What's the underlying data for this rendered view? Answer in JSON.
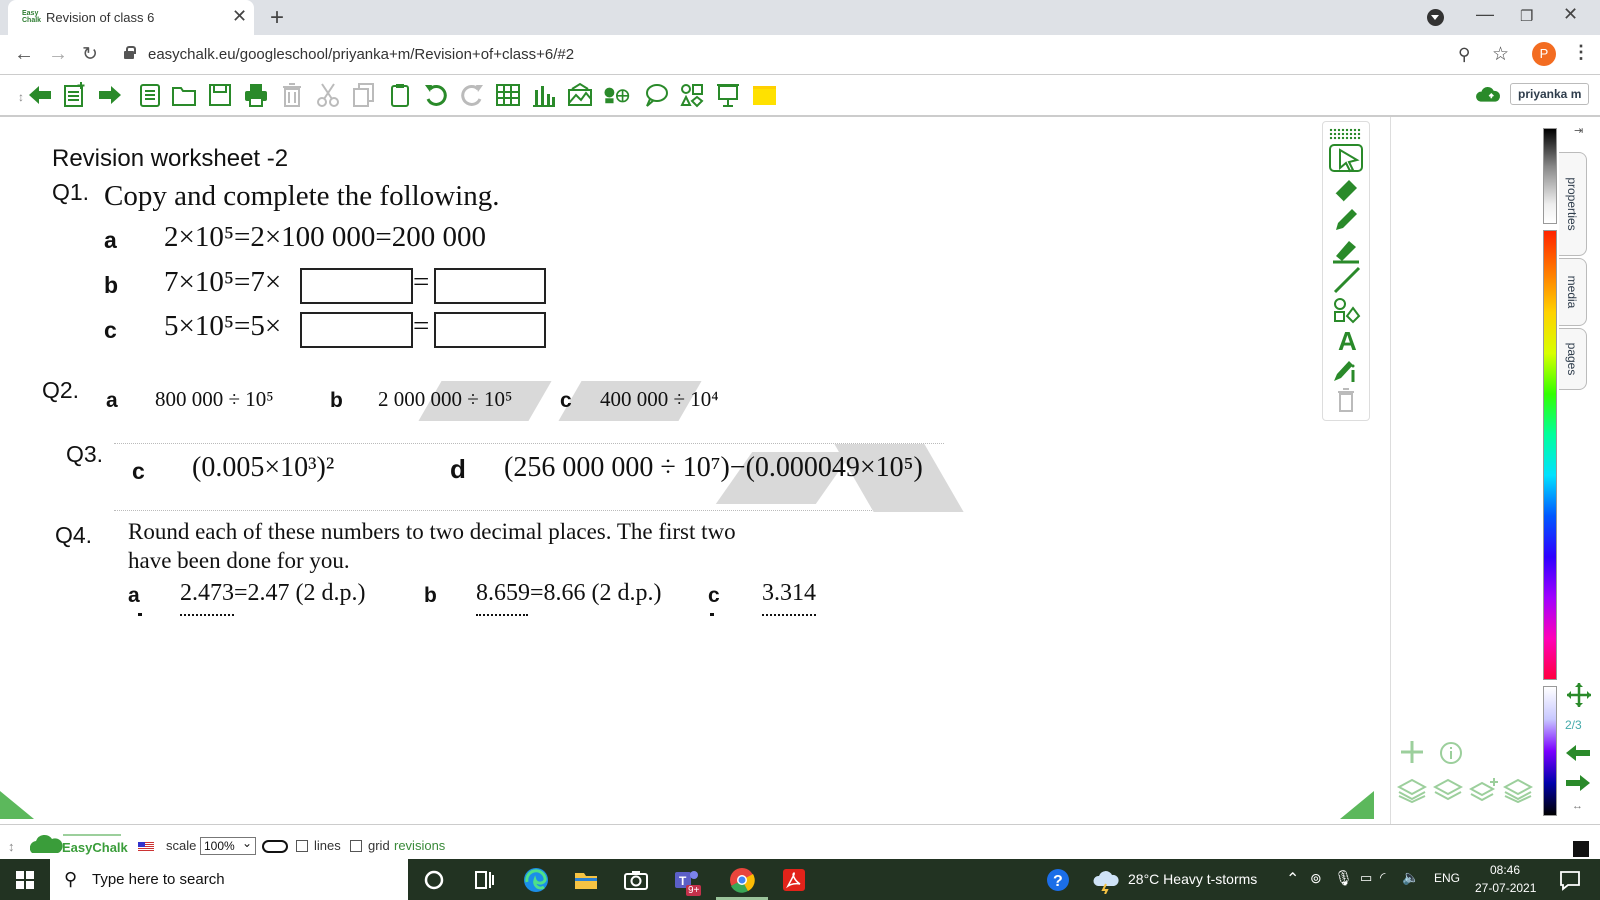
{
  "browser": {
    "tab_title": "Revision of class 6",
    "tab_favicon_text": "Easy Chalk",
    "new_tab_label": "+",
    "url": "easychalk.eu/googleschool/priyanka+m/Revision+of+class+6/#2",
    "profile_initial": "P"
  },
  "toolbar": {
    "user_name": "priyanka m",
    "colors": {
      "accent": "#2a8a2a",
      "sticky": "#ffe100"
    }
  },
  "worksheet": {
    "title": "Revision worksheet -2",
    "q1": {
      "label": "Q1.",
      "text": "Copy and complete the following.",
      "rows": [
        {
          "letter": "a",
          "expr": "2×10⁵=2×100 000=200 000"
        },
        {
          "letter": "b",
          "expr": "7×10⁵=7×",
          "eq": "="
        },
        {
          "letter": "c",
          "expr": "5×10⁵=5×",
          "eq": "="
        }
      ]
    },
    "q2": {
      "label": "Q2.",
      "parts": [
        {
          "letter": "a",
          "expr": "800 000 ÷ 10⁵"
        },
        {
          "letter": "b",
          "expr": "2 000 000 ÷ 10⁵"
        },
        {
          "letter": "c",
          "expr": "400 000 ÷ 10⁴"
        }
      ]
    },
    "q3": {
      "label": "Q3.",
      "parts": [
        {
          "letter": "c",
          "expr": "(0.005×10³)²"
        },
        {
          "letter": "d",
          "expr": "(256 000 000 ÷ 10⁷)−(0.000049×10⁵)"
        }
      ]
    },
    "q4": {
      "label": "Q4.",
      "line1": "Round each of these numbers to two decimal places. The first two",
      "line2": "have been done for you.",
      "parts": [
        {
          "letter": "a",
          "expr": "2.473=2.47 (2 d.p.)"
        },
        {
          "letter": "b",
          "expr": "8.659=8.66 (2 d.p.)"
        },
        {
          "letter": "c",
          "expr": "3.314"
        }
      ]
    }
  },
  "sidepanel": {
    "tabs": [
      "properties",
      "media",
      "pages"
    ],
    "page_counter": "2/3"
  },
  "statusbar": {
    "logo_text": "EasyChalk",
    "scale_label": "scale",
    "scale_value": "100%",
    "lines_label": "lines",
    "grid_label": "grid",
    "revisions_label": "revisions"
  },
  "taskbar": {
    "search_placeholder": "Type here to search",
    "teams_badge": "9+",
    "weather": "28°C  Heavy t-storms",
    "language": "ENG",
    "time": "08:46",
    "date": "27-07-2021"
  }
}
